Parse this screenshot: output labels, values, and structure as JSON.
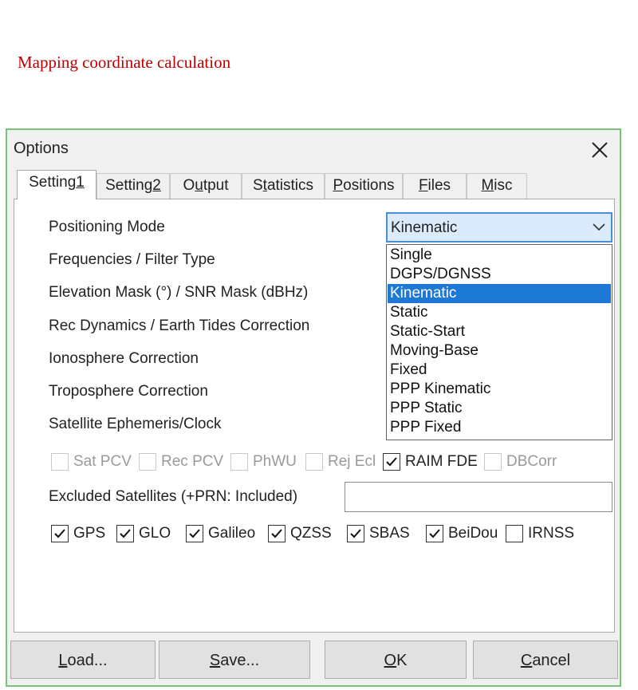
{
  "page_heading": "Mapping coordinate calculation",
  "dialog": {
    "title": "Options",
    "close_icon": "close-icon",
    "tabs": [
      {
        "label": "Setting",
        "accel": "1"
      },
      {
        "label": "Setting",
        "accel": "2"
      },
      {
        "pre": "O",
        "accel": "u",
        "post": "tput"
      },
      {
        "pre": "S",
        "accel": "t",
        "post": "atistics"
      },
      {
        "accel": "P",
        "post": "ositions"
      },
      {
        "accel": "F",
        "post": "iles"
      },
      {
        "accel": "M",
        "post": "isc"
      }
    ],
    "labels": {
      "positioning_mode": "Positioning Mode",
      "frequencies": "Frequencies / Filter Type",
      "elevation_mask": "Elevation Mask (°) / SNR Mask (dBHz)",
      "rec_dynamics": "Rec Dynamics / Earth Tides Correction",
      "ionosphere": "Ionosphere Correction",
      "troposphere": "Troposphere Correction",
      "ephemeris": "Satellite Ephemeris/Clock",
      "excluded_sats": "Excluded Satellites (+PRN: Included)"
    },
    "positioning_mode": {
      "value": "Kinematic",
      "options": [
        "Single",
        "DGPS/DGNSS",
        "Kinematic",
        "Static",
        "Static-Start",
        "Moving-Base",
        "Fixed",
        "PPP Kinematic",
        "PPP Static",
        "PPP Fixed"
      ],
      "selected_index": 2
    },
    "corrections": [
      {
        "label": "Sat PCV",
        "checked": false,
        "enabled": false
      },
      {
        "label": "Rec PCV",
        "checked": false,
        "enabled": false
      },
      {
        "label": "PhWU",
        "checked": false,
        "enabled": false
      },
      {
        "label": "Rej Ecl",
        "checked": false,
        "enabled": false
      },
      {
        "label": "RAIM FDE",
        "checked": true,
        "enabled": true
      },
      {
        "label": "DBCorr",
        "checked": false,
        "enabled": false
      }
    ],
    "excluded_satellites_value": "",
    "systems": [
      {
        "label": "GPS",
        "checked": true
      },
      {
        "label": "GLO",
        "checked": true
      },
      {
        "label": "Galileo",
        "checked": true
      },
      {
        "label": "QZSS",
        "checked": true
      },
      {
        "label": "SBAS",
        "checked": true
      },
      {
        "label": "BeiDou",
        "checked": true
      },
      {
        "label": "IRNSS",
        "checked": false
      }
    ],
    "buttons": {
      "load": {
        "accel": "L",
        "post": "oad..."
      },
      "save": {
        "accel": "S",
        "post": "ave..."
      },
      "ok": {
        "accel": "O",
        "post": "K"
      },
      "cancel": {
        "accel": "C",
        "post": "ancel"
      }
    }
  }
}
